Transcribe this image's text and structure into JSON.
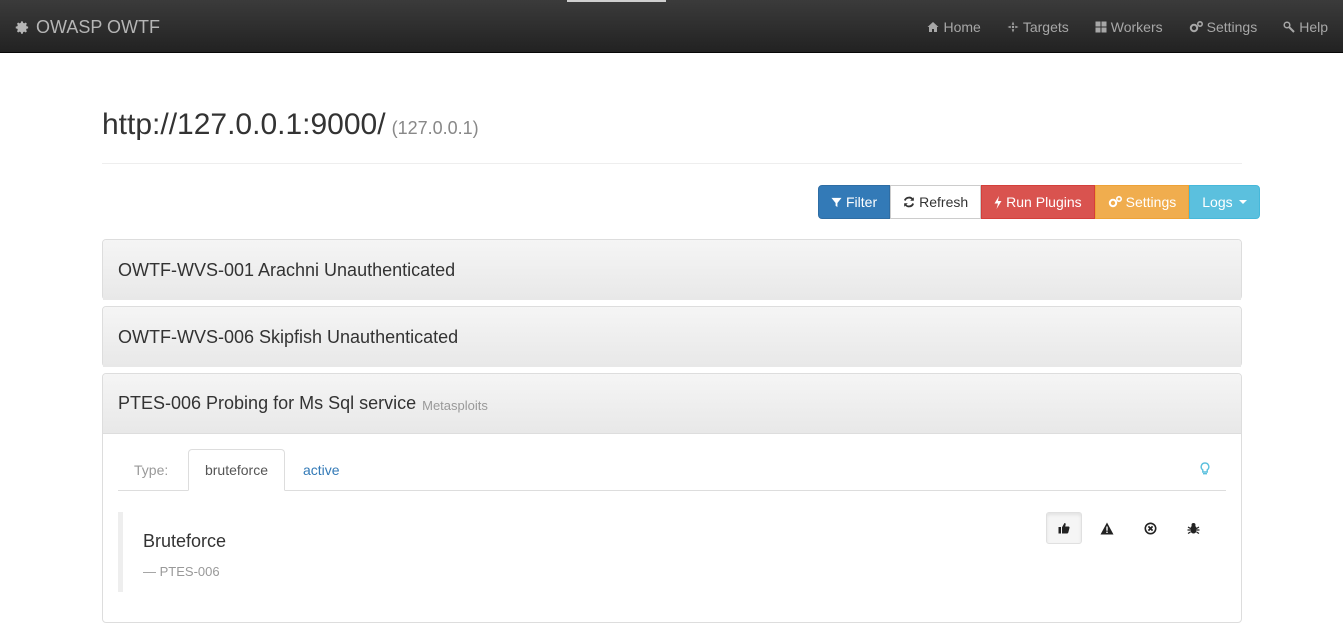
{
  "navbar": {
    "brand": "OWASP OWTF",
    "items": [
      {
        "label": "Home",
        "icon": "home-icon"
      },
      {
        "label": "Targets",
        "icon": "crosshairs-icon"
      },
      {
        "label": "Workers",
        "icon": "th-large-icon"
      },
      {
        "label": "Settings",
        "icon": "gears-icon"
      },
      {
        "label": "Help",
        "icon": "link-icon"
      }
    ]
  },
  "target": {
    "url": "http://127.0.0.1:9000/",
    "ip": "(127.0.0.1)"
  },
  "toolbar": {
    "filter": "Filter",
    "refresh": "Refresh",
    "run_plugins": "Run Plugins",
    "settings": "Settings",
    "logs": "Logs"
  },
  "plugins": [
    {
      "title": "OWTF-WVS-001 Arachni Unauthenticated",
      "subtitle": ""
    },
    {
      "title": "OWTF-WVS-006 Skipfish Unauthenticated",
      "subtitle": ""
    },
    {
      "title": "PTES-006 Probing for Ms Sql service",
      "subtitle": "Metasploits"
    }
  ],
  "plugin_detail": {
    "type_label": "Type:",
    "tabs": [
      "bruteforce",
      "active"
    ],
    "active_tab": "bruteforce",
    "heading": "Bruteforce",
    "source": "— PTES-006",
    "actions": [
      "thumbs-up-icon",
      "warning-icon",
      "circle-x-icon",
      "bug-icon"
    ]
  },
  "colors": {
    "primary": "#337ab7",
    "danger": "#d9534f",
    "warning": "#f0ad4e",
    "info": "#5bc0de",
    "navbar": "#222222"
  }
}
